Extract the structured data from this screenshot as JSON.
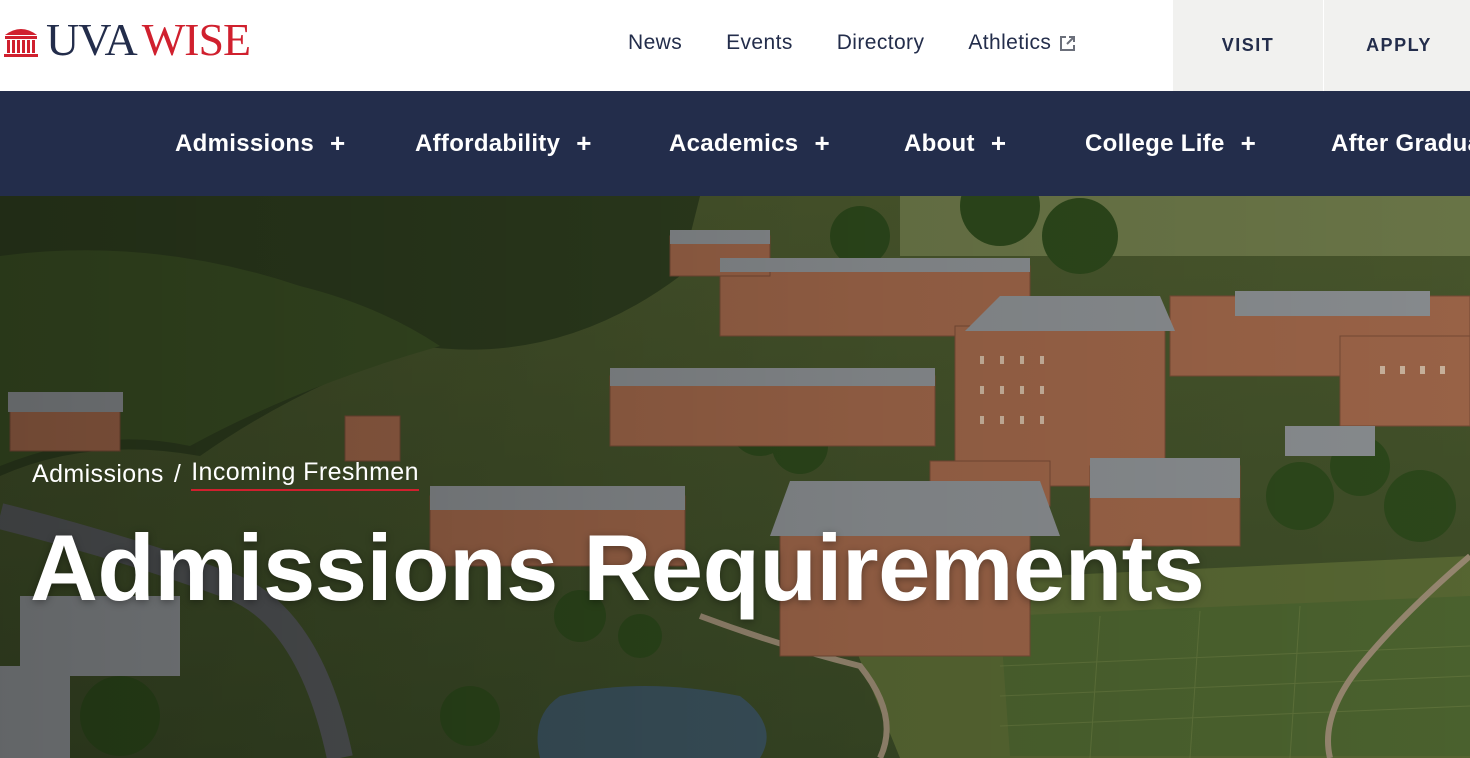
{
  "brand": {
    "name_part1": "UVA",
    "name_part2": "WISE",
    "colors": {
      "navy": "#232d4b",
      "red": "#d0202e",
      "light_gray": "#f1f1ef"
    }
  },
  "utility_nav": {
    "items": [
      {
        "label": "News"
      },
      {
        "label": "Events"
      },
      {
        "label": "Directory"
      },
      {
        "label": "Athletics",
        "icon": "external-link-icon"
      }
    ]
  },
  "cta": {
    "visit_label": "VISIT",
    "apply_label": "APPLY"
  },
  "main_nav": {
    "items": [
      {
        "label": "Admissions",
        "expand_icon": "+"
      },
      {
        "label": "Affordability",
        "expand_icon": "+"
      },
      {
        "label": "Academics",
        "expand_icon": "+"
      },
      {
        "label": "About",
        "expand_icon": "+"
      },
      {
        "label": "College Life",
        "expand_icon": "+"
      },
      {
        "label": "After Gradua"
      }
    ]
  },
  "hero": {
    "breadcrumb": {
      "parent": "Admissions",
      "separator": "/",
      "current": "Incoming Freshmen"
    },
    "title": "Admissions Requirements",
    "image": "aerial-campus-photo"
  }
}
